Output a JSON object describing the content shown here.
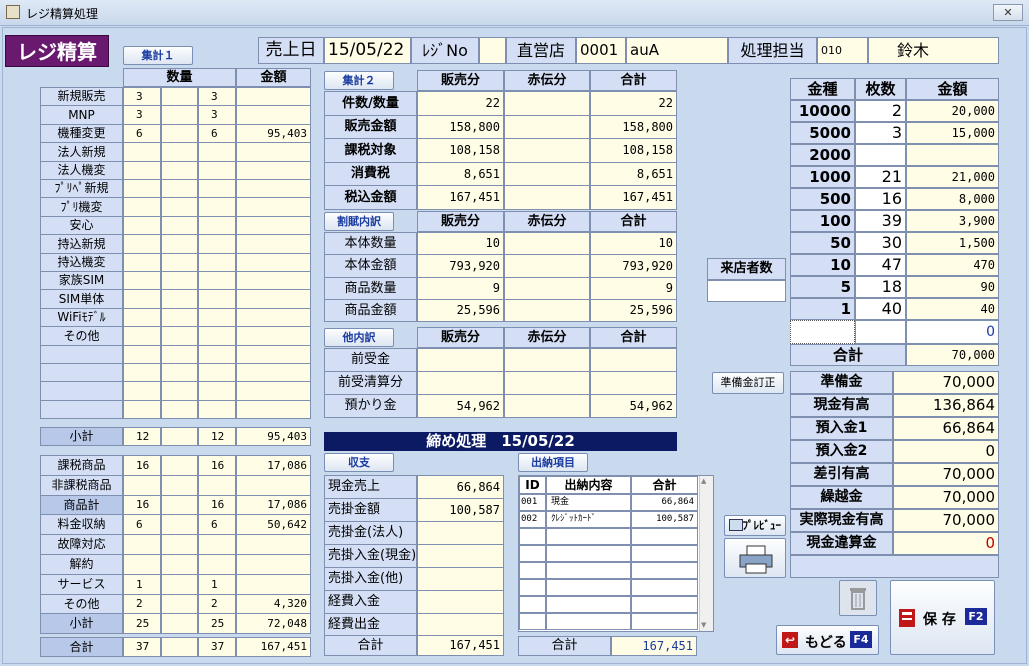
{
  "window": {
    "title": "レジ精算処理",
    "close": "✕"
  },
  "app_title": "レジ精算",
  "header": {
    "sales_date_label": "売上日",
    "sales_date": "15/05/22",
    "register_label": "ﾚｼﾞNo",
    "register_no": "",
    "store_label": "直営店",
    "store_code": "0001",
    "store_name": "auA",
    "staff_label": "処理担当",
    "staff_code": "010",
    "staff_name": "鈴木"
  },
  "sum1": {
    "button": "集計１",
    "headers": {
      "qty": "数量",
      "amount": "金額"
    },
    "rows": [
      {
        "label": "新規販売",
        "q1": "3",
        "q2": "",
        "q3": "3",
        "amt": ""
      },
      {
        "label": "MNP",
        "q1": "3",
        "q2": "",
        "q3": "3",
        "amt": ""
      },
      {
        "label": "機種変更",
        "q1": "6",
        "q2": "",
        "q3": "6",
        "amt": "95,403"
      },
      {
        "label": "法人新規",
        "q1": "",
        "q2": "",
        "q3": "",
        "amt": ""
      },
      {
        "label": "法人機変",
        "q1": "",
        "q2": "",
        "q3": "",
        "amt": ""
      },
      {
        "label": "ﾌﾟﾘﾍﾟ新規",
        "q1": "",
        "q2": "",
        "q3": "",
        "amt": ""
      },
      {
        "label": "ﾌﾟﾘ機変",
        "q1": "",
        "q2": "",
        "q3": "",
        "amt": ""
      },
      {
        "label": "安心",
        "q1": "",
        "q2": "",
        "q3": "",
        "amt": ""
      },
      {
        "label": "持込新規",
        "q1": "",
        "q2": "",
        "q3": "",
        "amt": ""
      },
      {
        "label": "持込機変",
        "q1": "",
        "q2": "",
        "q3": "",
        "amt": ""
      },
      {
        "label": "家族SIM",
        "q1": "",
        "q2": "",
        "q3": "",
        "amt": ""
      },
      {
        "label": "SIM単体",
        "q1": "",
        "q2": "",
        "q3": "",
        "amt": ""
      },
      {
        "label": "WiFiﾓﾃﾞﾙ",
        "q1": "",
        "q2": "",
        "q3": "",
        "amt": ""
      },
      {
        "label": "その他",
        "q1": "",
        "q2": "",
        "q3": "",
        "amt": ""
      },
      {
        "label": "",
        "q1": "",
        "q2": "",
        "q3": "",
        "amt": ""
      },
      {
        "label": "",
        "q1": "",
        "q2": "",
        "q3": "",
        "amt": ""
      },
      {
        "label": "",
        "q1": "",
        "q2": "",
        "q3": "",
        "amt": ""
      },
      {
        "label": "",
        "q1": "",
        "q2": "",
        "q3": "",
        "amt": ""
      }
    ],
    "subtotal": {
      "label": "小計",
      "q1": "12",
      "q2": "",
      "q3": "12",
      "amt": "95,403"
    },
    "rows2": [
      {
        "label": "課税商品",
        "q1": "16",
        "q2": "",
        "q3": "16",
        "amt": "17,086"
      },
      {
        "label": "非課税商品",
        "q1": "",
        "q2": "",
        "q3": "",
        "amt": ""
      },
      {
        "label": "商品計",
        "q1": "16",
        "q2": "",
        "q3": "16",
        "amt": "17,086"
      },
      {
        "label": "料金収納",
        "q1": "6",
        "q2": "",
        "q3": "6",
        "amt": "50,642"
      },
      {
        "label": "故障対応",
        "q1": "",
        "q2": "",
        "q3": "",
        "amt": ""
      },
      {
        "label": "解約",
        "q1": "",
        "q2": "",
        "q3": "",
        "amt": ""
      },
      {
        "label": "サービス",
        "q1": "1",
        "q2": "",
        "q3": "1",
        "amt": ""
      },
      {
        "label": "その他",
        "q1": "2",
        "q2": "",
        "q3": "2",
        "amt": "4,320"
      },
      {
        "label": "小計",
        "q1": "25",
        "q2": "",
        "q3": "25",
        "amt": "72,048"
      }
    ],
    "total": {
      "label": "合計",
      "q1": "37",
      "q2": "",
      "q3": "37",
      "amt": "167,451"
    }
  },
  "sum2": {
    "button": "集計２",
    "headers": [
      "販売分",
      "赤伝分",
      "合計"
    ],
    "rows": [
      {
        "label": "件数/数量",
        "a": "22",
        "b": "",
        "c": "22"
      },
      {
        "label": "販売金額",
        "a": "158,800",
        "b": "",
        "c": "158,800"
      },
      {
        "label": "課税対象",
        "a": "108,158",
        "b": "",
        "c": "108,158"
      },
      {
        "label": "消費税",
        "a": "8,651",
        "b": "",
        "c": "8,651"
      },
      {
        "label": "税込金額",
        "a": "167,451",
        "b": "",
        "c": "167,451"
      }
    ]
  },
  "discount": {
    "button": "割賦内訳",
    "headers": [
      "販売分",
      "赤伝分",
      "合計"
    ],
    "rows": [
      {
        "label": "本体数量",
        "a": "10",
        "b": "",
        "c": "10"
      },
      {
        "label": "本体金額",
        "a": "793,920",
        "b": "",
        "c": "793,920"
      },
      {
        "label": "商品数量",
        "a": "9",
        "b": "",
        "c": "9"
      },
      {
        "label": "商品金額",
        "a": "25,596",
        "b": "",
        "c": "25,596"
      }
    ]
  },
  "other": {
    "button": "他内訳",
    "headers": [
      "販売分",
      "赤伝分",
      "合計"
    ],
    "rows": [
      {
        "label": "前受金",
        "a": "",
        "b": "",
        "c": ""
      },
      {
        "label": "前受清算分",
        "a": "",
        "b": "",
        "c": ""
      },
      {
        "label": "預かり金",
        "a": "54,962",
        "b": "",
        "c": "54,962"
      }
    ]
  },
  "closing_bar": "締め処理　15/05/22",
  "balance": {
    "button": "収支",
    "rows": [
      {
        "label": "現金売上",
        "val": "66,864"
      },
      {
        "label": "売掛金額",
        "val": "100,587"
      },
      {
        "label": "売掛金(法人)",
        "val": ""
      },
      {
        "label": "売掛入金(現金)",
        "val": ""
      },
      {
        "label": "売掛入金(他)",
        "val": ""
      },
      {
        "label": "経費入金",
        "val": ""
      },
      {
        "label": "経費出金",
        "val": ""
      }
    ],
    "total_label": "合計",
    "total": "167,451"
  },
  "deposit": {
    "button": "出納項目",
    "headers": [
      "ID",
      "出納内容",
      "合計"
    ],
    "rows": [
      {
        "id": "001",
        "name": "現金",
        "amt": "66,864"
      },
      {
        "id": "002",
        "name": "ｸﾚｼﾞｯﾄｶｰﾄﾞ",
        "amt": "100,587"
      },
      {
        "id": "",
        "name": "",
        "amt": ""
      },
      {
        "id": "",
        "name": "",
        "amt": ""
      },
      {
        "id": "",
        "name": "",
        "amt": ""
      },
      {
        "id": "",
        "name": "",
        "amt": ""
      },
      {
        "id": "",
        "name": "",
        "amt": ""
      },
      {
        "id": "",
        "name": "",
        "amt": ""
      }
    ],
    "total_label": "合計",
    "total": "167,451"
  },
  "visitors": {
    "label": "来店者数",
    "value": ""
  },
  "reserve_fix_button": "準備金訂正",
  "denominations": {
    "headers": [
      "金種",
      "枚数",
      "金額"
    ],
    "rows": [
      {
        "d": "10000",
        "n": "2",
        "amt": "20,000"
      },
      {
        "d": "5000",
        "n": "3",
        "amt": "15,000"
      },
      {
        "d": "2000",
        "n": "",
        "amt": ""
      },
      {
        "d": "1000",
        "n": "21",
        "amt": "21,000"
      },
      {
        "d": "500",
        "n": "16",
        "amt": "8,000"
      },
      {
        "d": "100",
        "n": "39",
        "amt": "3,900"
      },
      {
        "d": "50",
        "n": "30",
        "amt": "1,500"
      },
      {
        "d": "10",
        "n": "47",
        "amt": "470"
      },
      {
        "d": "5",
        "n": "18",
        "amt": "90"
      },
      {
        "d": "1",
        "n": "40",
        "amt": "40"
      }
    ],
    "extra_value": "0",
    "total_label": "合計",
    "total": "70,000"
  },
  "cash": {
    "rows": [
      {
        "label": "準備金",
        "val": "70,000"
      },
      {
        "label": "現金有高",
        "val": "136,864"
      },
      {
        "label": "預入金1",
        "val": "66,864"
      },
      {
        "label": "預入金2",
        "val": "0"
      },
      {
        "label": "差引有高",
        "val": "70,000"
      },
      {
        "label": "繰越金",
        "val": "70,000"
      },
      {
        "label": "実際現金有高",
        "val": "70,000"
      },
      {
        "label": "現金違算金",
        "val": "0"
      }
    ],
    "diff_color": "#c00000"
  },
  "buttons": {
    "preview": "ﾌﾟﾚﾋﾞｭｰ",
    "back": "もどる",
    "back_key": "F4",
    "save": "保 存",
    "save_key": "F2"
  },
  "colors": {
    "brand": "#6a1a6e",
    "navy": "#0c1a64",
    "input": "#fffde6",
    "label": "#d4dff5"
  }
}
